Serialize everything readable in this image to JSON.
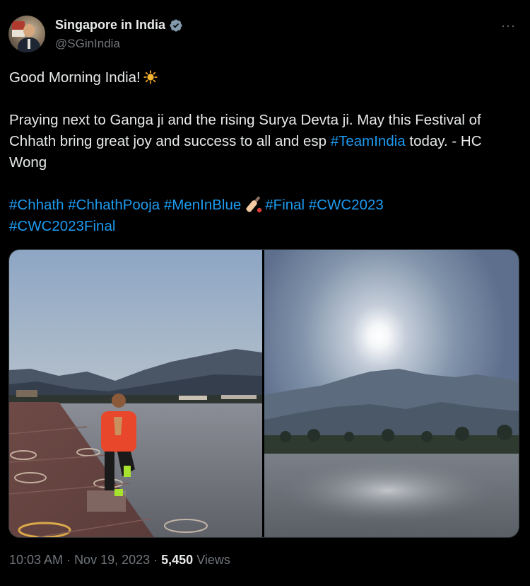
{
  "account": {
    "display_name": "Singapore in India",
    "handle": "@SGinIndia",
    "verified_icon": "verified-badge-icon",
    "more_icon": "ellipsis-icon",
    "more_label": "···"
  },
  "tweet": {
    "greeting": "Good Morning India!",
    "line2_part1": "Praying next to Ganga ji and the rising Surya Devta ji. May this Festival of Chhath bring great joy and success to all and esp ",
    "line2_tag": "#TeamIndia",
    "line2_part2": " today. - HC Wong",
    "hashtags": {
      "h1": "#Chhath",
      "h2": "#ChhathPooja",
      "h3": "#MenInBlue",
      "h4": "#Final",
      "h5": "#CWC2023",
      "h6": "#CWC2023Final"
    }
  },
  "media": {
    "photo_left": "photo-man-yoga-pose-riverbank",
    "photo_right": "photo-rising-sun-over-river"
  },
  "meta": {
    "time": "10:03 AM",
    "sep1": " · ",
    "date": "Nov 19, 2023",
    "sep2": " · ",
    "views_count": "5,450",
    "views_label": " Views"
  },
  "colors": {
    "background": "#000000",
    "text": "#e7e9ea",
    "muted": "#71767b",
    "link": "#1d9bf0"
  }
}
